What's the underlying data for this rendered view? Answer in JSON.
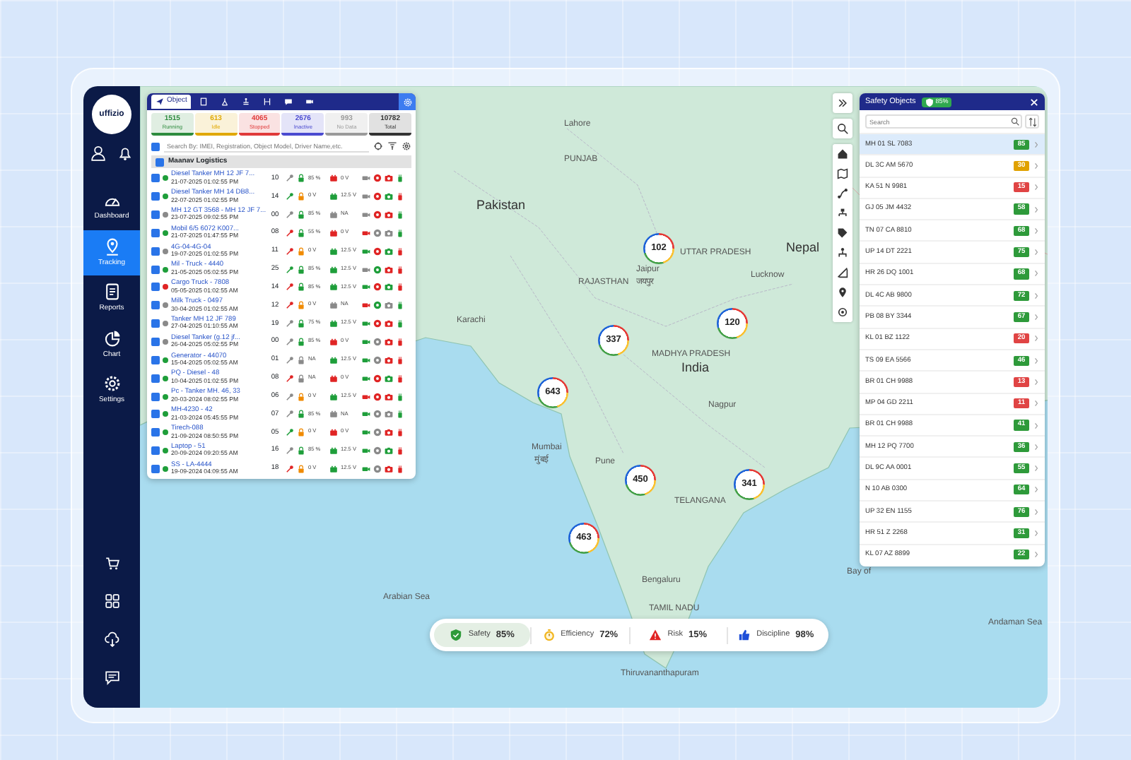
{
  "sidebar": {
    "logo": "uffizio",
    "nav": [
      {
        "label": "Dashboard",
        "selected": false
      },
      {
        "label": "Tracking",
        "selected": true
      },
      {
        "label": "Reports",
        "selected": false
      },
      {
        "label": "Chart",
        "selected": false
      },
      {
        "label": "Settings",
        "selected": false
      }
    ]
  },
  "object_panel": {
    "tabs": [
      {
        "label": "Object",
        "selected": true
      },
      {
        "selected": false
      },
      {
        "selected": false
      },
      {
        "selected": false
      },
      {
        "selected": false
      },
      {
        "selected": false
      },
      {
        "selected": false
      }
    ],
    "counts": [
      {
        "value": "1515",
        "label": "Running",
        "color": "#2e8b3e"
      },
      {
        "value": "613",
        "label": "Idle",
        "color": "#e0a800"
      },
      {
        "value": "4065",
        "label": "Stopped",
        "color": "#e03a3a"
      },
      {
        "value": "2676",
        "label": "Inactive",
        "color": "#4a4ad0"
      },
      {
        "value": "993",
        "label": "No Data",
        "color": "#9a9a9a"
      },
      {
        "value": "10782",
        "label": "Total",
        "color": "#333333"
      }
    ],
    "search": {
      "placeholder": "Search By: IMEI, Registration, Object Model, Driver Name,etc."
    },
    "select_all": {
      "checked": true
    },
    "group": {
      "name": "Maanav Logistics",
      "checked": true
    },
    "rows": [
      {
        "name": "Diesel Tanker MH 12 JF 7...",
        "time": "21-07-2025 01:02:55 PM",
        "count": "10",
        "checked": true,
        "color": "#1e9e3a",
        "lock_text": "85 %",
        "battery_text": "0 V",
        "icons": [
          {
            "color": "#8a8a8a"
          },
          {
            "color": "#1e9e3a"
          },
          {
            "color": "#e02424"
          },
          {
            "color": "#8a8a8a"
          },
          {
            "color": "#e02424"
          },
          {
            "color": "#e02424"
          },
          {
            "color": "#1e9e3a"
          }
        ]
      },
      {
        "name": "Diesel Tanker MH 14 DB8...",
        "time": "22-07-2025 01:02:55 PM",
        "count": "14",
        "checked": true,
        "color": "#1e9e3a",
        "lock_text": "0 V",
        "battery_text": "12.5 V",
        "icons": [
          {
            "color": "#1e9e3a"
          },
          {
            "color": "#f08a00"
          },
          {
            "color": "#1e9e3a"
          },
          {
            "color": "#8a8a8a"
          },
          {
            "color": "#e02424"
          },
          {
            "color": "#1e9e3a"
          },
          {
            "color": "#e02424"
          }
        ]
      },
      {
        "name": "MH 12 GT 3568 - MH 12 JF 7...",
        "time": "23-07-2025 09:02:55 PM",
        "count": "00",
        "checked": true,
        "color": "#8a8a8a",
        "lock_text": "85 %",
        "battery_text": "NA",
        "icons": [
          {
            "color": "#8a8a8a"
          },
          {
            "color": "#1e9e3a"
          },
          {
            "color": "#8a8a8a"
          },
          {
            "color": "#8a8a8a"
          },
          {
            "color": "#e02424"
          },
          {
            "color": "#e02424"
          },
          {
            "color": "#1e9e3a"
          }
        ]
      },
      {
        "name": "Mobil 6/5 6072 K007...",
        "time": "21-07-2025 01:47:55 PM",
        "count": "08",
        "checked": true,
        "color": "#1e9e3a",
        "lock_text": "55 %",
        "battery_text": "0 V",
        "icons": [
          {
            "color": "#e02424"
          },
          {
            "color": "#1e9e3a"
          },
          {
            "color": "#e02424"
          },
          {
            "color": "#e02424"
          },
          {
            "color": "#8a8a8a"
          },
          {
            "color": "#8a8a8a"
          },
          {
            "color": "#1e9e3a"
          }
        ]
      },
      {
        "name": "4G-04-4G-04",
        "time": "19-07-2025 01:02:55 PM",
        "count": "11",
        "checked": true,
        "color": "#8a8a8a",
        "lock_text": "0 V",
        "battery_text": "12.5 V",
        "icons": [
          {
            "color": "#e02424"
          },
          {
            "color": "#f08a00"
          },
          {
            "color": "#1e9e3a"
          },
          {
            "color": "#1e9e3a"
          },
          {
            "color": "#e02424"
          },
          {
            "color": "#1e9e3a"
          },
          {
            "color": "#e02424"
          }
        ]
      },
      {
        "name": "Mil - Truck - 4440",
        "time": "21-05-2025 05:02:55 PM",
        "count": "25",
        "checked": true,
        "color": "#1e9e3a",
        "lock_text": "85 %",
        "battery_text": "12.5 V",
        "icons": [
          {
            "color": "#1e9e3a"
          },
          {
            "color": "#1e9e3a"
          },
          {
            "color": "#1e9e3a"
          },
          {
            "color": "#8a8a8a"
          },
          {
            "color": "#1e9e3a"
          },
          {
            "color": "#e02424"
          },
          {
            "color": "#e02424"
          }
        ]
      },
      {
        "name": "Cargo Truck - 7808",
        "time": "05-05-2025 01:02:55 AM",
        "count": "14",
        "checked": true,
        "color": "#e02424",
        "lock_text": "85 %",
        "battery_text": "12.5 V",
        "icons": [
          {
            "color": "#e02424"
          },
          {
            "color": "#1e9e3a"
          },
          {
            "color": "#1e9e3a"
          },
          {
            "color": "#1e9e3a"
          },
          {
            "color": "#e02424"
          },
          {
            "color": "#1e9e3a"
          },
          {
            "color": "#e02424"
          }
        ]
      },
      {
        "name": "Milk Truck - 0497",
        "time": "30-04-2025 01:02:55 AM",
        "count": "12",
        "checked": true,
        "color": "#8a8a8a",
        "lock_text": "0 V",
        "battery_text": "NA",
        "icons": [
          {
            "color": "#e02424"
          },
          {
            "color": "#f08a00"
          },
          {
            "color": "#8a8a8a"
          },
          {
            "color": "#e02424"
          },
          {
            "color": "#1e9e3a"
          },
          {
            "color": "#8a8a8a"
          },
          {
            "color": "#1e9e3a"
          }
        ]
      },
      {
        "name": "Tanker MH 12 JF 789",
        "time": "27-04-2025 01:10:55 AM",
        "count": "19",
        "checked": true,
        "color": "#8a8a8a",
        "lock_text": "75 %",
        "battery_text": "12.5 V",
        "icons": [
          {
            "color": "#8a8a8a"
          },
          {
            "color": "#1e9e3a"
          },
          {
            "color": "#1e9e3a"
          },
          {
            "color": "#1e9e3a"
          },
          {
            "color": "#e02424"
          },
          {
            "color": "#e02424"
          },
          {
            "color": "#1e9e3a"
          }
        ]
      },
      {
        "name": "Diesel Tanker (g.12 jf...",
        "time": "26-04-2025 05:02:55 PM",
        "count": "00",
        "checked": true,
        "color": "#8a8a8a",
        "lock_text": "85 %",
        "battery_text": "0 V",
        "icons": [
          {
            "color": "#8a8a8a"
          },
          {
            "color": "#1e9e3a"
          },
          {
            "color": "#e02424"
          },
          {
            "color": "#1e9e3a"
          },
          {
            "color": "#8a8a8a"
          },
          {
            "color": "#e02424"
          },
          {
            "color": "#e02424"
          }
        ]
      },
      {
        "name": "Generator - 44070",
        "time": "15-04-2025 05:02:55 AM",
        "count": "01",
        "checked": true,
        "color": "#1e9e3a",
        "lock_text": "NA",
        "battery_text": "12.5 V",
        "icons": [
          {
            "color": "#8a8a8a"
          },
          {
            "color": "#8a8a8a"
          },
          {
            "color": "#1e9e3a"
          },
          {
            "color": "#1e9e3a"
          },
          {
            "color": "#8a8a8a"
          },
          {
            "color": "#e02424"
          },
          {
            "color": "#e02424"
          }
        ]
      },
      {
        "name": "PQ - Diesel - 48",
        "time": "10-04-2025 01:02:55 PM",
        "count": "08",
        "checked": true,
        "color": "#1e9e3a",
        "lock_text": "NA",
        "battery_text": "0 V",
        "icons": [
          {
            "color": "#e02424"
          },
          {
            "color": "#8a8a8a"
          },
          {
            "color": "#e02424"
          },
          {
            "color": "#1e9e3a"
          },
          {
            "color": "#e02424"
          },
          {
            "color": "#1e9e3a"
          },
          {
            "color": "#e02424"
          }
        ]
      },
      {
        "name": "Pc - Tanker MH. 46, 33",
        "time": "20-03-2024 08:02:55 PM",
        "count": "06",
        "checked": true,
        "color": "#1e9e3a",
        "lock_text": "0 V",
        "battery_text": "12.5 V",
        "icons": [
          {
            "color": "#8a8a8a"
          },
          {
            "color": "#f08a00"
          },
          {
            "color": "#1e9e3a"
          },
          {
            "color": "#e02424"
          },
          {
            "color": "#e02424"
          },
          {
            "color": "#e02424"
          },
          {
            "color": "#1e9e3a"
          }
        ]
      },
      {
        "name": "MH-4230 - 42",
        "time": "21-03-2024 05:45:55 PM",
        "count": "07",
        "checked": true,
        "color": "#1e9e3a",
        "lock_text": "85 %",
        "battery_text": "NA",
        "icons": [
          {
            "color": "#8a8a8a"
          },
          {
            "color": "#1e9e3a"
          },
          {
            "color": "#8a8a8a"
          },
          {
            "color": "#1e9e3a"
          },
          {
            "color": "#8a8a8a"
          },
          {
            "color": "#8a8a8a"
          },
          {
            "color": "#1e9e3a"
          }
        ]
      },
      {
        "name": "Tirech-088",
        "time": "21-09-2024 08:50:55 PM",
        "count": "05",
        "checked": true,
        "color": "#1e9e3a",
        "lock_text": "0 V",
        "battery_text": "0 V",
        "icons": [
          {
            "color": "#1e9e3a"
          },
          {
            "color": "#f08a00"
          },
          {
            "color": "#e02424"
          },
          {
            "color": "#1e9e3a"
          },
          {
            "color": "#8a8a8a"
          },
          {
            "color": "#e02424"
          },
          {
            "color": "#e02424"
          }
        ]
      },
      {
        "name": "Laptop - 51",
        "time": "20-09-2024 09:20:55 AM",
        "count": "16",
        "checked": true,
        "color": "#1e9e3a",
        "lock_text": "85 %",
        "battery_text": "12.5 V",
        "icons": [
          {
            "color": "#8a8a8a"
          },
          {
            "color": "#1e9e3a"
          },
          {
            "color": "#1e9e3a"
          },
          {
            "color": "#1e9e3a"
          },
          {
            "color": "#8a8a8a"
          },
          {
            "color": "#1e9e3a"
          },
          {
            "color": "#e02424"
          }
        ]
      },
      {
        "name": "SS - LA-4444",
        "time": "19-09-2024 04:09:55 AM",
        "count": "18",
        "checked": true,
        "color": "#1e9e3a",
        "lock_text": "0 V",
        "battery_text": "12.5 V",
        "icons": [
          {
            "color": "#e02424"
          },
          {
            "color": "#f08a00"
          },
          {
            "color": "#1e9e3a"
          },
          {
            "color": "#1e9e3a"
          },
          {
            "color": "#8a8a8a"
          },
          {
            "color": "#e02424"
          },
          {
            "color": "#e02424"
          }
        ]
      }
    ]
  },
  "map": {
    "labels": [
      "Lahore",
      "PUNJAB",
      "Pakistan",
      "Jaipur",
      "जयपुर",
      "UTTAR PRADESH",
      "Lucknow",
      "Nepal",
      "RAJASTHAN",
      "Karachi",
      "MADHYA PRADESH",
      "India",
      "Nagpur",
      "Mumbai",
      "मुंबई",
      "Pune",
      "TELANGANA",
      "Bengaluru",
      "TAMIL NADU",
      "Arabian Sea",
      "Bay of",
      "Andaman Sea",
      "Thiruvananthapuram"
    ],
    "clusters": [
      {
        "count": "102"
      },
      {
        "count": "120"
      },
      {
        "count": "337"
      },
      {
        "count": "643"
      },
      {
        "count": "450"
      },
      {
        "count": "341"
      },
      {
        "count": "463"
      }
    ]
  },
  "safety_panel": {
    "title": "Safety Objects",
    "badge": "85%",
    "search": {
      "placeholder": "Search"
    },
    "items": [
      {
        "plate": "MH 01 SL 7083",
        "score": "85",
        "color": "#2e9a3a",
        "selected": true
      },
      {
        "plate": "DL 3C AM 5670",
        "score": "30",
        "color": "#e0a100",
        "selected": false
      },
      {
        "plate": "KA 51 N 9981",
        "score": "15",
        "color": "#e04444",
        "selected": false
      },
      {
        "plate": "GJ 05 JM 4432",
        "score": "58",
        "color": "#2e9a3a",
        "selected": false
      },
      {
        "plate": "TN 07 CA 8810",
        "score": "68",
        "color": "#2e9a3a",
        "selected": false
      },
      {
        "plate": "UP 14 DT 2221",
        "score": "75",
        "color": "#2e9a3a",
        "selected": false
      },
      {
        "plate": "HR 26 DQ 1001",
        "score": "68",
        "color": "#2e9a3a",
        "selected": false
      },
      {
        "plate": "DL 4C AB 9800",
        "score": "72",
        "color": "#2e9a3a",
        "selected": false
      },
      {
        "plate": "PB 08 BY 3344",
        "score": "67",
        "color": "#2e9a3a",
        "selected": false
      },
      {
        "plate": "KL 01 BZ 1122",
        "score": "20",
        "color": "#e04444",
        "selected": false
      },
      {
        "plate": "TS 09 EA 5566",
        "score": "46",
        "color": "#2e9a3a",
        "selected": false
      },
      {
        "plate": "BR 01 CH 9988",
        "score": "13",
        "color": "#e04444",
        "selected": false
      },
      {
        "plate": "MP 04 GD 2211",
        "score": "11",
        "color": "#e04444",
        "selected": false
      },
      {
        "plate": "BR 01 CH 9988",
        "score": "41",
        "color": "#2e9a3a",
        "selected": false
      },
      {
        "plate": "MH 12 PQ 7700",
        "score": "36",
        "color": "#2e9a3a",
        "selected": false
      },
      {
        "plate": "DL 9C AA 0001",
        "score": "55",
        "color": "#2e9a3a",
        "selected": false
      },
      {
        "plate": "N 10 AB 0300",
        "score": "64",
        "color": "#2e9a3a",
        "selected": false
      },
      {
        "plate": "UP 32 EN 1155",
        "score": "76",
        "color": "#2e9a3a",
        "selected": false
      },
      {
        "plate": "HR 51 Z 2268",
        "score": "31",
        "color": "#2e9a3a",
        "selected": false
      },
      {
        "plate": "KL 07 AZ 8899",
        "score": "22",
        "color": "#2e9a3a",
        "selected": false
      }
    ]
  },
  "metrics": [
    {
      "label": "Safety",
      "value": "85%",
      "selected": true
    },
    {
      "label": "Efficiency",
      "value": "72%",
      "selected": false
    },
    {
      "label": "Risk",
      "value": "15%",
      "selected": false
    },
    {
      "label": "Discipline",
      "value": "98%",
      "selected": false
    }
  ]
}
